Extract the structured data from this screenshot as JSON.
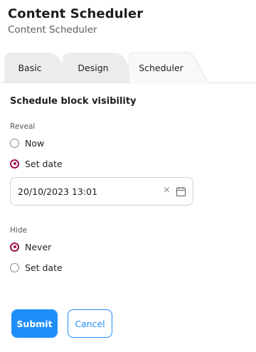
{
  "header": {
    "title": "Content Scheduler",
    "subtitle": "Content Scheduler"
  },
  "tabs": [
    {
      "label": "Basic",
      "active": false
    },
    {
      "label": "Design",
      "active": false
    },
    {
      "label": "Scheduler",
      "active": true
    }
  ],
  "section": {
    "title": "Schedule block visibility"
  },
  "reveal": {
    "label": "Reveal",
    "options": [
      {
        "label": "Now",
        "checked": false
      },
      {
        "label": "Set date",
        "checked": true
      }
    ],
    "date_value": "20/10/2023 13:01",
    "clear_glyph": "×"
  },
  "hide": {
    "label": "Hide",
    "options": [
      {
        "label": "Never",
        "checked": true
      },
      {
        "label": "Set date",
        "checked": false
      }
    ]
  },
  "actions": {
    "submit_label": "Submit",
    "cancel_label": "Cancel"
  },
  "colors": {
    "accent_radio": "#9c1650",
    "primary_button": "#1f8efa",
    "inactive_tab": "#ececec",
    "active_tab": "#f8f8f8"
  },
  "icons": {
    "clear": "clear-icon",
    "calendar": "calendar-icon"
  }
}
